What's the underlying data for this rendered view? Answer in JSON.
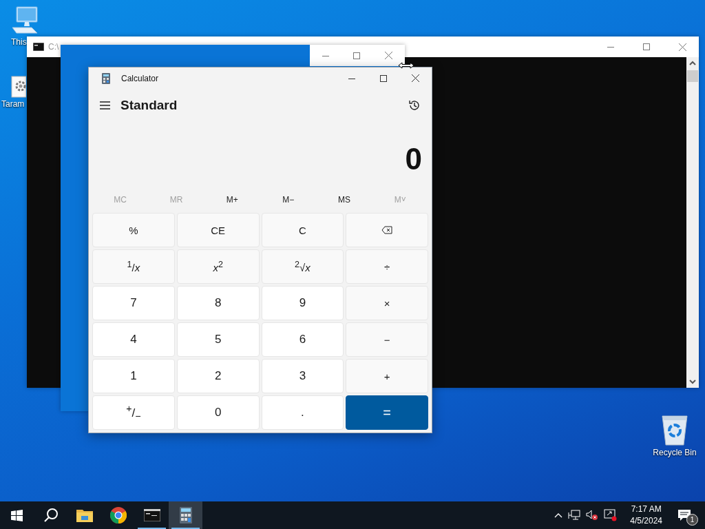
{
  "desktop_icons": [
    {
      "kind": "computer",
      "label": "This"
    },
    {
      "kind": "settings-file",
      "label": "Taram"
    },
    {
      "kind": "recycle-bin",
      "label": "Recycle Bin"
    }
  ],
  "console_window": {
    "title": "C:\\"
  },
  "calculator": {
    "title": "Calculator",
    "mode": "Standard",
    "display": "0",
    "memory": [
      {
        "label": "MC",
        "disabled": true
      },
      {
        "label": "MR",
        "disabled": true
      },
      {
        "label": "M+",
        "disabled": false
      },
      {
        "label": "M−",
        "disabled": false
      },
      {
        "label": "MS",
        "disabled": false
      },
      {
        "label": "M˅",
        "disabled": true
      }
    ],
    "keys": [
      {
        "kind": "function",
        "label": "%"
      },
      {
        "kind": "function",
        "label": "CE"
      },
      {
        "kind": "function",
        "label": "C"
      },
      {
        "kind": "backspace"
      },
      {
        "kind": "function",
        "label": "$^{1}$/*x*"
      },
      {
        "kind": "function",
        "label": "*x*$^{2}$"
      },
      {
        "kind": "function",
        "label": "$^{2}$√*x*"
      },
      {
        "kind": "function",
        "label": "÷"
      },
      {
        "kind": "number",
        "label": "7"
      },
      {
        "kind": "number",
        "label": "8"
      },
      {
        "kind": "number",
        "label": "9"
      },
      {
        "kind": "function",
        "label": "×"
      },
      {
        "kind": "number",
        "label": "4"
      },
      {
        "kind": "number",
        "label": "5"
      },
      {
        "kind": "number",
        "label": "6"
      },
      {
        "kind": "function",
        "label": "−"
      },
      {
        "kind": "number",
        "label": "1"
      },
      {
        "kind": "number",
        "label": "2"
      },
      {
        "kind": "number",
        "label": "3"
      },
      {
        "kind": "function",
        "label": "+"
      },
      {
        "kind": "number",
        "label": "$^{+}$/$_{−}$"
      },
      {
        "kind": "number",
        "label": "0"
      },
      {
        "kind": "number",
        "label": "."
      },
      {
        "kind": "equals",
        "label": "="
      }
    ]
  },
  "taskbar": {
    "apps": [
      {
        "kind": "start",
        "running": false,
        "selected": false
      },
      {
        "kind": "search",
        "running": false,
        "selected": false
      },
      {
        "kind": "explorer",
        "running": false,
        "selected": false
      },
      {
        "kind": "chrome",
        "running": false,
        "selected": false
      },
      {
        "kind": "console",
        "running": true,
        "selected": false
      },
      {
        "kind": "calculator",
        "running": true,
        "selected": true
      }
    ],
    "time": "7:17 AM",
    "date": "4/5/2024",
    "notification_count": "1"
  }
}
